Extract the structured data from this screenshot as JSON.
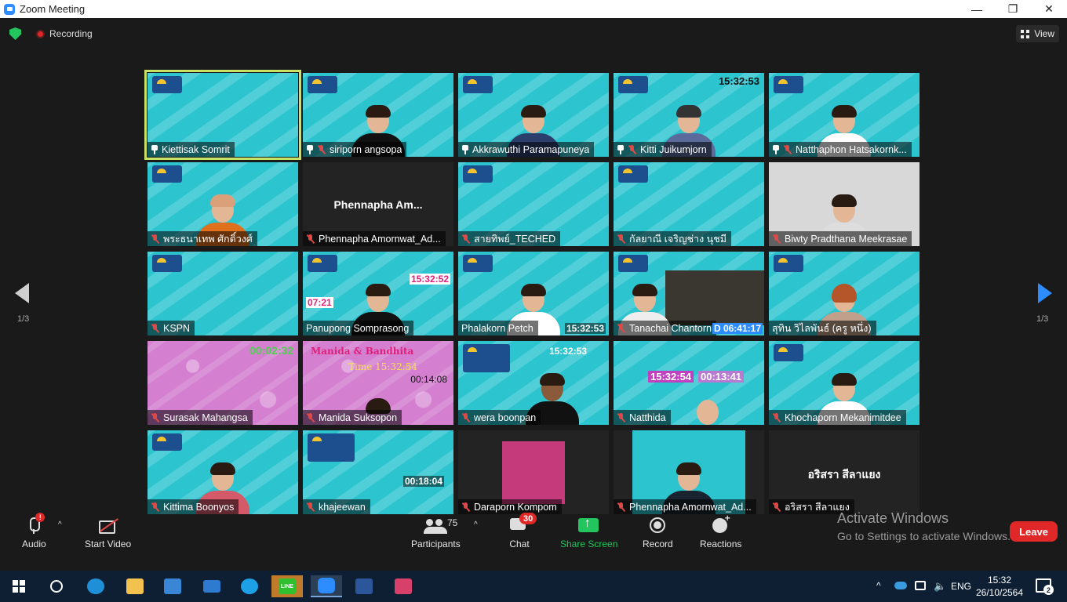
{
  "window": {
    "title": "Zoom Meeting",
    "controls": [
      "—",
      "❐",
      "✕"
    ]
  },
  "topbar": {
    "recording_label": "Recording",
    "view_label": "View"
  },
  "participants": [
    {
      "name": "Kiettisak Somrit",
      "muted": false,
      "pinned_icon": true
    },
    {
      "name": "siriporn angsopa",
      "muted": true,
      "pinned_icon": true
    },
    {
      "name": "Akkrawuthi Paramapuneya",
      "muted": false,
      "pinned_icon": true,
      "active": true
    },
    {
      "name": "Kitti Juikumjorn",
      "muted": true,
      "pinned_icon": true,
      "clock": "15:32:53"
    },
    {
      "name": "Natthaphon Hatsakornk...",
      "muted": true,
      "pinned_icon": true
    },
    {
      "name": "พระธนาเทพ ศักดิ์วงศ์",
      "muted": true
    },
    {
      "name": "Phennapha Amornwat_Ad...",
      "muted": true,
      "center_name": "Phennapha  Am..."
    },
    {
      "name": "สายทิพย์_TECHED",
      "muted": true
    },
    {
      "name": "กัลยาณี เจริญช่าง นุชมี",
      "muted": true
    },
    {
      "name": "Biwty Pradthana Meekrasae",
      "muted": true
    },
    {
      "name": "KSPN",
      "muted": true
    },
    {
      "name": "Panupong Somprasong",
      "muted": false,
      "clock": "15:32:52",
      "clock2": "07:21"
    },
    {
      "name": "Phalakorn Petch",
      "muted": false,
      "clock": "15:32:53"
    },
    {
      "name": "Tanachai Chantorn",
      "muted": true,
      "clock": "D 06:41:17"
    },
    {
      "name": "สุทิน วิไลพันธ์ (ครู หนึ่ง)",
      "muted": true
    },
    {
      "name": "Surasak Mahangsa",
      "muted": true,
      "clock": "00:02:32"
    },
    {
      "name": "Manida Suksopon",
      "muted": true,
      "overlay_title": "Manida & Bandhita",
      "overlay_time": "Time 15:32:54",
      "clock": "00:14:08"
    },
    {
      "name": "wera boonpan",
      "muted": true,
      "clock": "15:32:53"
    },
    {
      "name": "Natthida",
      "muted": true,
      "clock": "15:32:54",
      "clock2": "00:13:41"
    },
    {
      "name": "Khochaporn Mekanimitdee",
      "muted": true
    },
    {
      "name": "Kittima Boonyos",
      "muted": true
    },
    {
      "name": "khajeewan",
      "muted": true,
      "clock": "00:18:04"
    },
    {
      "name": "Daraporn Kompom",
      "muted": true
    },
    {
      "name": "Phennapha Amornwat_Ad...",
      "muted": true
    },
    {
      "name": "อริสรา สีลาแยง",
      "muted": true,
      "center_name": "อริสรา สีลาแยง"
    }
  ],
  "pagination": {
    "left": "1/3",
    "right": "1/3"
  },
  "watermark": {
    "line1": "Activate Windows",
    "line2": "Go to Settings to activate Windows."
  },
  "toolbar": {
    "audio": "Audio",
    "audio_alert": "!",
    "video": "Start Video",
    "participants": "Participants",
    "participants_count": "75",
    "chat": "Chat",
    "chat_badge": "30",
    "share": "Share Screen",
    "record": "Record",
    "reactions": "Reactions",
    "leave": "Leave"
  },
  "taskbar": {
    "lang": "ENG",
    "time": "15:32",
    "date": "26/10/2564",
    "notification_count": "2",
    "line_app_label": "LINE"
  },
  "colors": {
    "share_green": "#23c55e",
    "leave_red": "#e02828",
    "active_outline": "#c9e265",
    "tile_teal": "#2bc4cf"
  }
}
